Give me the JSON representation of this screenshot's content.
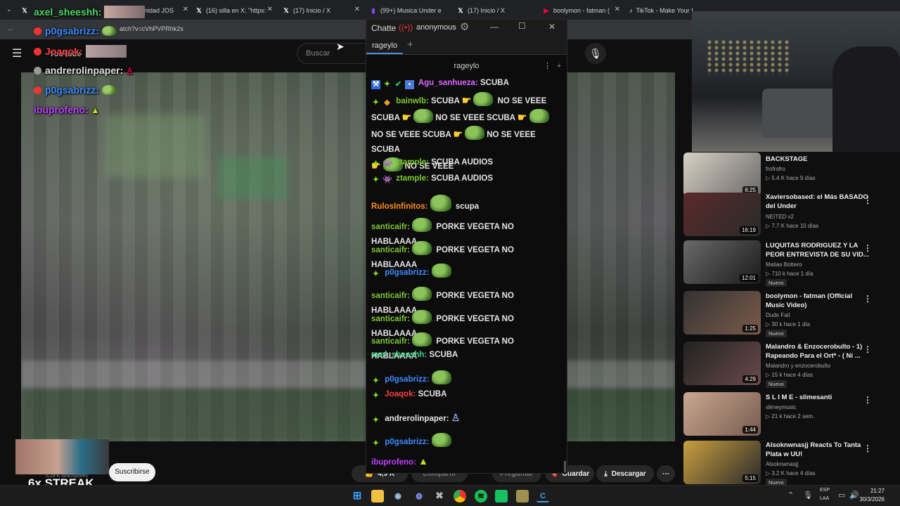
{
  "browser": {
    "tabs": [
      {
        "title": "axel_sheeshh",
        "icon": "x-icon"
      },
      {
        "title": "unidad JOS",
        "icon": "doc-icon"
      },
      {
        "title": "(16) silla en X: \"https:",
        "icon": "x-icon"
      },
      {
        "title": "(17) Inicio / X",
        "icon": "x-icon"
      },
      {
        "title": "(99+) Musica Under e",
        "icon": "twitch-icon"
      },
      {
        "title": "(17) Inicio / X",
        "icon": "x-icon"
      },
      {
        "title": "boolymon - fatman (",
        "icon": "youtube-icon"
      },
      {
        "title": "TikTok - Make Your D",
        "icon": "tiktok-icon"
      }
    ],
    "url": "atch?v=cVhPVPRhk2s"
  },
  "youtube": {
    "logo": "YouTube",
    "search_placeholder": "Buscar",
    "subscribe_label": "Suscribirse",
    "subscribers": "5,28 K suscriptores",
    "streak_label": "6x STREAK",
    "likes": "4,9 K",
    "share_label": "Compartir",
    "ask_label": "Preguntar",
    "save_label": "Guardar",
    "download_label": "Descargar"
  },
  "overlay_chat": [
    {
      "user": "axel_sheeshh:",
      "color": "#4cd964"
    },
    {
      "user": "p0gsabrizz:",
      "color": "#3b8bff"
    },
    {
      "user": "Joaqok:",
      "color": "#ff4040"
    },
    {
      "user": "andrerolinpaper:",
      "color": "#e0e0e0"
    },
    {
      "user": "p0gsabrizz:",
      "color": "#3b8bff"
    },
    {
      "user": "ibuprofeno:",
      "color": "#c040ff"
    }
  ],
  "chatterino": {
    "title": "Chatte",
    "status": "anonymous",
    "tab": "rageylo",
    "channel": "rageylo",
    "messages": [
      {
        "user": "Agu_sanhueza:",
        "color": "#e066ff",
        "text": "SCUBA"
      },
      {
        "user": "bainwlb:",
        "color": "#7ec832",
        "text": "SCUBA",
        "spam": [
          "NO SE VEEE",
          "SCUBA",
          "NO SE VEEE SCUBA",
          "NO SE VEEE SCUBA",
          "NO SE VEEE SCUBA",
          "NO SE VEEE"
        ]
      },
      {
        "user": "ztample:",
        "color": "#7ec832",
        "text": "SCUBA AUDIOS"
      },
      {
        "user": "ztample:",
        "color": "#7ec832",
        "text": "SCUBA AUDIOS"
      },
      {
        "user": "RulosInfinitos:",
        "color": "#ff8c1a",
        "text": "scupa"
      },
      {
        "user": "santicaifr:",
        "color": "#7ec832",
        "text": "PORKE VEGETA NO HABLAAAA"
      },
      {
        "user": "santicaifr:",
        "color": "#7ec832",
        "text": "PORKE VEGETA NO HABLAAAA"
      },
      {
        "user": "p0gsabrizz:",
        "color": "#3b8bff",
        "text": ""
      },
      {
        "user": "santicaifr:",
        "color": "#7ec832",
        "text": "PORKE VEGETA NO HABLAAAA"
      },
      {
        "user": "santicaifr:",
        "color": "#7ec832",
        "text": "PORKE VEGETA NO HABLAAAA"
      },
      {
        "user": "santicaifr:",
        "color": "#7ec832",
        "text": "PORKE VEGETA NO HABLAAAA"
      },
      {
        "user": "axel_sheeshh:",
        "color": "#44d488",
        "text": "SCUBA"
      },
      {
        "user": "p0gsabrizz:",
        "color": "#3b8bff",
        "text": ""
      },
      {
        "user": "Joaqok:",
        "color": "#ff4040",
        "text": "SCUBA"
      },
      {
        "user": "andrerolinpaper:",
        "color": "#e6e6e6",
        "text": ""
      },
      {
        "user": "p0gsabrizz:",
        "color": "#3b8bff",
        "text": ""
      },
      {
        "user": "ibuprofeno:",
        "color": "#c040ff",
        "text": ""
      }
    ]
  },
  "recommendations": [
    {
      "title": "BACKSTAGE",
      "channel": "frofrofro",
      "meta": "▷ 5.4 K  hace 9 días",
      "duration": "6:25",
      "new": ""
    },
    {
      "title": "Xaviersobased: el Más BASADO del Under",
      "channel": "NEITED v2",
      "meta": "▷ 7.7 K  hace 10 días",
      "duration": "16:19",
      "new": ""
    },
    {
      "title": "LUQUITAS RODRIGUEZ Y LA PEOR ENTREVISTA DE SU VID...",
      "channel": "Matias Bottero",
      "meta": "▷ 710 k  hace 1 día",
      "duration": "12:01",
      "new": "Nuevo"
    },
    {
      "title": "boolymon - fatman (Official Music Video)",
      "channel": "Dude Fail",
      "meta": "▷ 30 k  hace 1 día",
      "duration": "1:25",
      "new": "Nuevo"
    },
    {
      "title": "Malandro & Enzocerobulto - 1) Rapeando Para el Ort* - ( Ni ...",
      "channel": "Malandro y enzocerobulto",
      "meta": "▷ 15 k  hace 4 días",
      "duration": "4:29",
      "new": "Nuevo"
    },
    {
      "title": "S L I M E - slimesanti",
      "channel": "slimeymusic",
      "meta": "▷ 21 k  hace 2 sem.",
      "duration": "1:44",
      "new": ""
    },
    {
      "title": "Alsoknwnasjj Reacts To Tanta Plata w UU!",
      "channel": "Alsoknwnasjj",
      "meta": "▷ 3.2 K  hace 4 días",
      "duration": "5:15",
      "new": "Nuevo"
    }
  ],
  "taskbar": {
    "lang": "ESP",
    "layout": "LAA",
    "time": "21:27",
    "date": "30/3/2026"
  },
  "colors": {
    "bg": "#0f0f0f",
    "chat_bg": "#0c0c0c",
    "accent_red": "#ff0033"
  }
}
